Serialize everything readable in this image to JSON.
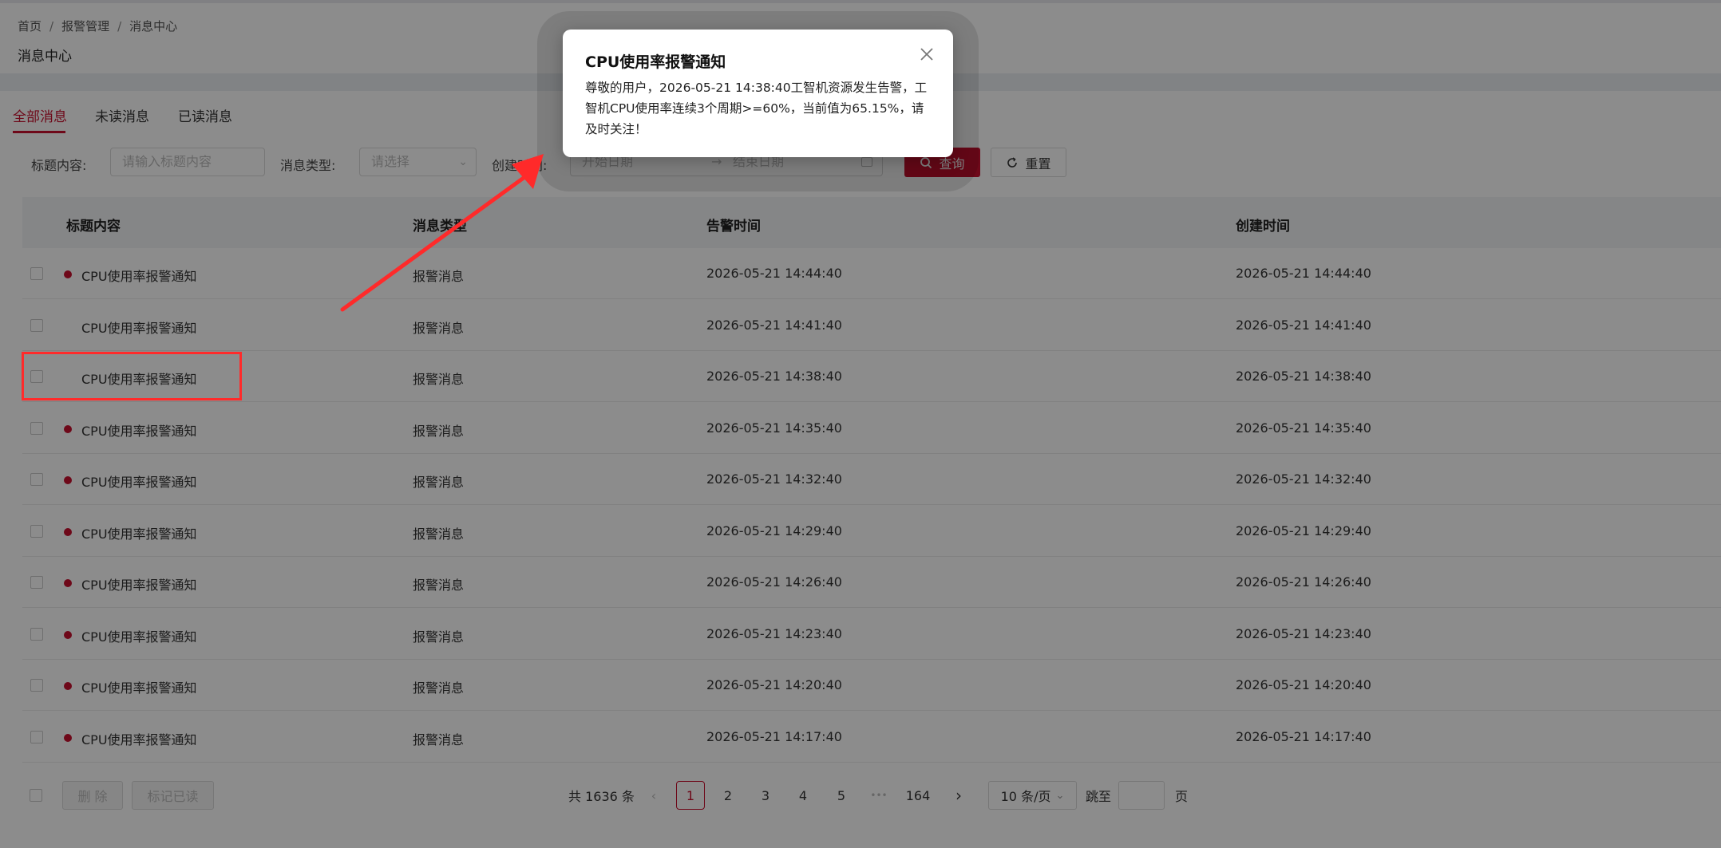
{
  "breadcrumb": [
    "首页",
    "报警管理",
    "消息中心"
  ],
  "page_title": "消息中心",
  "tabs": [
    {
      "label": "全部消息",
      "active": true
    },
    {
      "label": "未读消息",
      "active": false
    },
    {
      "label": "已读消息",
      "active": false
    }
  ],
  "filters": {
    "title_label": "标题内容:",
    "title_placeholder": "请输入标题内容",
    "type_label": "消息类型:",
    "type_placeholder": "请选择",
    "created_label": "创建时间:",
    "start_placeholder": "开始日期",
    "end_placeholder": "结束日期",
    "query_label": "查询",
    "reset_label": "重置"
  },
  "table": {
    "columns": [
      "标题内容",
      "消息类型",
      "告警时间",
      "创建时间"
    ],
    "rows": [
      {
        "title": "CPU使用率报警通知",
        "type": "报警消息",
        "alarm_time": "2026-05-21 14:44:40",
        "created_time": "2026-05-21 14:44:40",
        "unread": true
      },
      {
        "title": "CPU使用率报警通知",
        "type": "报警消息",
        "alarm_time": "2026-05-21 14:41:40",
        "created_time": "2026-05-21 14:41:40",
        "unread": false
      },
      {
        "title": "CPU使用率报警通知",
        "type": "报警消息",
        "alarm_time": "2026-05-21 14:38:40",
        "created_time": "2026-05-21 14:38:40",
        "unread": false
      },
      {
        "title": "CPU使用率报警通知",
        "type": "报警消息",
        "alarm_time": "2026-05-21 14:35:40",
        "created_time": "2026-05-21 14:35:40",
        "unread": true
      },
      {
        "title": "CPU使用率报警通知",
        "type": "报警消息",
        "alarm_time": "2026-05-21 14:32:40",
        "created_time": "2026-05-21 14:32:40",
        "unread": true
      },
      {
        "title": "CPU使用率报警通知",
        "type": "报警消息",
        "alarm_time": "2026-05-21 14:29:40",
        "created_time": "2026-05-21 14:29:40",
        "unread": true
      },
      {
        "title": "CPU使用率报警通知",
        "type": "报警消息",
        "alarm_time": "2026-05-21 14:26:40",
        "created_time": "2026-05-21 14:26:40",
        "unread": true
      },
      {
        "title": "CPU使用率报警通知",
        "type": "报警消息",
        "alarm_time": "2026-05-21 14:23:40",
        "created_time": "2026-05-21 14:23:40",
        "unread": true
      },
      {
        "title": "CPU使用率报警通知",
        "type": "报警消息",
        "alarm_time": "2026-05-21 14:20:40",
        "created_time": "2026-05-21 14:20:40",
        "unread": true
      },
      {
        "title": "CPU使用率报警通知",
        "type": "报警消息",
        "alarm_time": "2026-05-21 14:17:40",
        "created_time": "2026-05-21 14:17:40",
        "unread": true
      }
    ]
  },
  "footer": {
    "delete_label": "删 除",
    "mark_read_label": "标记已读",
    "total_text": "共 1636 条",
    "pages": [
      "1",
      "2",
      "3",
      "4",
      "5",
      "•••",
      "164"
    ],
    "current_page": "1",
    "page_size": "10 条/页",
    "jump_label": "跳至",
    "page_suffix": "页"
  },
  "modal": {
    "title": "CPU使用率报警通知",
    "body": "尊敬的用户，2026-05-21 14:38:40工智机资源发生告警，工智机CPU使用率连续3个周期>=60%，当前值为65.15%，请及时关注！"
  },
  "colors": {
    "accent": "#c8102e",
    "annotation": "#ff2a2a"
  }
}
